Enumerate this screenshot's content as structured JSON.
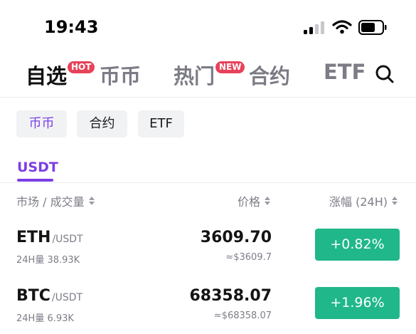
{
  "status_bar": {
    "time": "19:43"
  },
  "colors": {
    "accent": "#7b3ee6",
    "badge": "#e8425a",
    "up": "#20b78a",
    "chip_bg": "#f1f2f4"
  },
  "main_tabs": [
    {
      "label": "自选",
      "badge": "HOT"
    },
    {
      "label": "币币"
    },
    {
      "label": "热门",
      "badge": "NEW"
    },
    {
      "label": "合约"
    },
    {
      "label": "ETF"
    }
  ],
  "sub_tabs": [
    "币币",
    "合约",
    "ETF"
  ],
  "quote_tab": "USDT",
  "columns": {
    "market": "市场 / 成交量",
    "price": "价格",
    "change": "涨幅 (24H)"
  },
  "rows": [
    {
      "base": "ETH",
      "quote": "/USDT",
      "volume": "24H量 38.93K",
      "price": "3609.70",
      "fiat": "≈$3609.7",
      "change": "+0.82%"
    },
    {
      "base": "BTC",
      "quote": "/USDT",
      "volume": "24H量 6.93K",
      "price": "68358.07",
      "fiat": "≈$68358.07",
      "change": "+1.96%"
    }
  ]
}
